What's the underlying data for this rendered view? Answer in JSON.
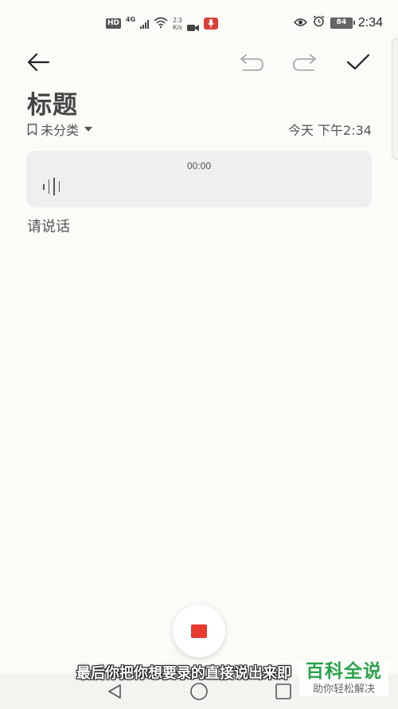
{
  "status_bar": {
    "hd": "HD",
    "network": "4G",
    "speed_value": "2.3",
    "speed_unit": "K/s",
    "battery": "84",
    "time": "2:34"
  },
  "note": {
    "title": "标题",
    "category": "未分类",
    "date": "今天 下午2:34",
    "recording_time": "00:00",
    "prompt": "请说话"
  },
  "caption": "最后你把你想要录的直接说出来即",
  "watermark": {
    "main": "百科全说",
    "sub": "助你轻松解决"
  },
  "colors": {
    "background": "#fbfbf8",
    "stop_button": "#e8392d",
    "watermark_green": "#2aa34a",
    "mic_badge": "#d9403a"
  }
}
